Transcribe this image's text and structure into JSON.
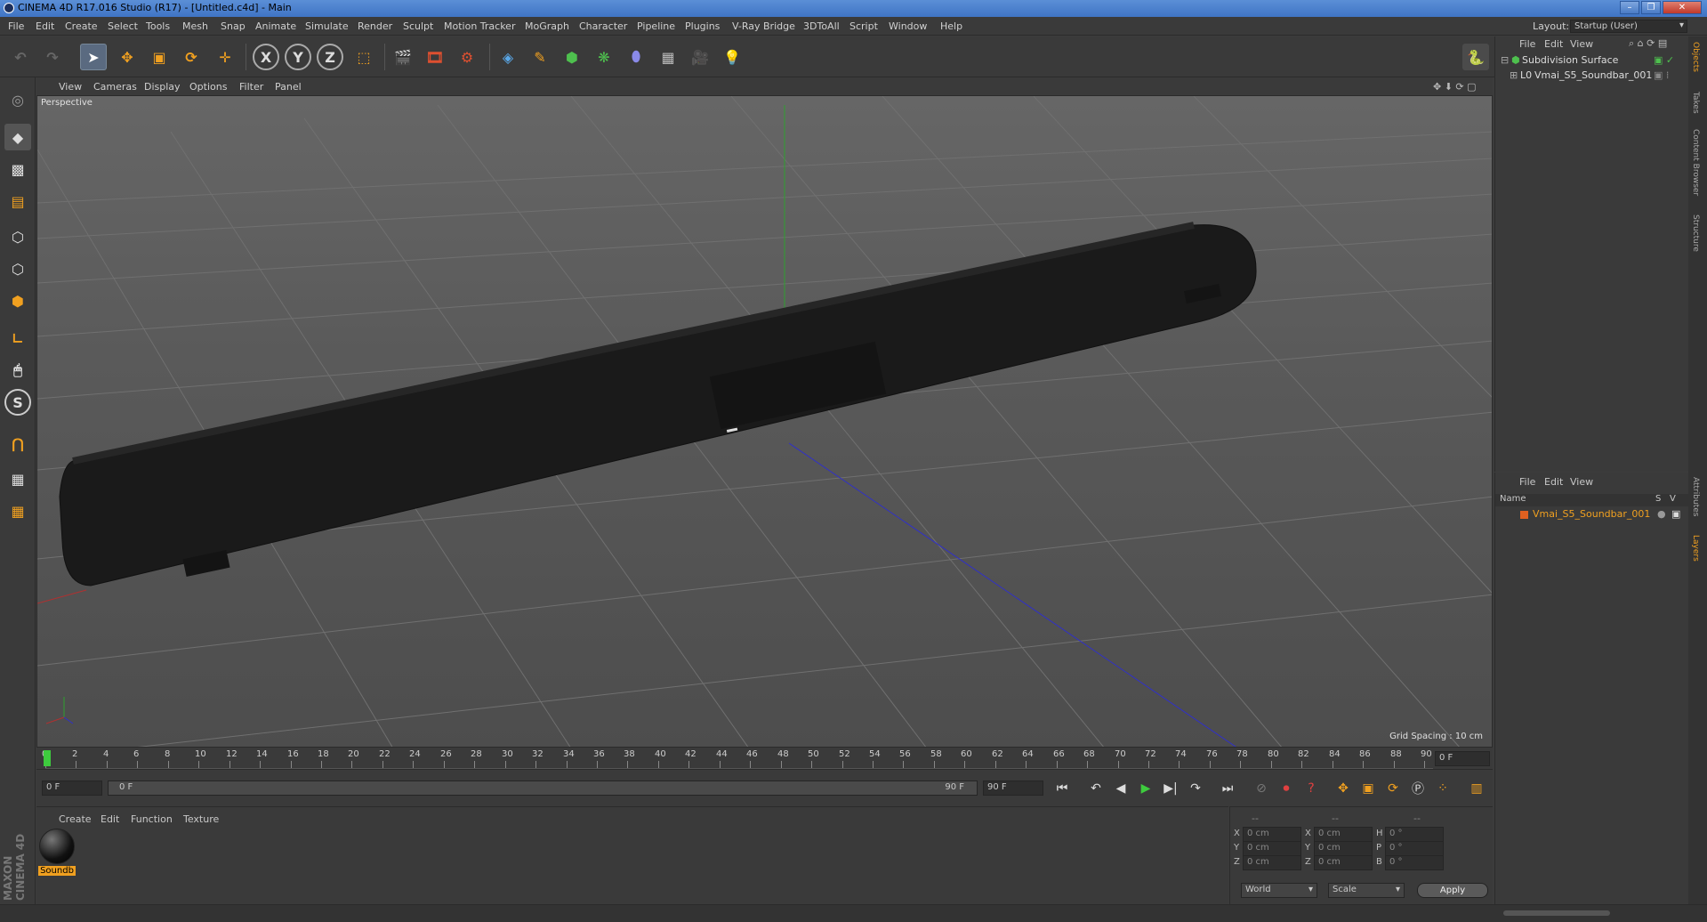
{
  "window": {
    "title": "CINEMA 4D R17.016 Studio (R17) - [Untitled.c4d] - Main"
  },
  "menu": [
    "File",
    "Edit",
    "Create",
    "Select",
    "Tools",
    "Mesh",
    "Snap",
    "Animate",
    "Simulate",
    "Render",
    "Sculpt",
    "Motion Tracker",
    "MoGraph",
    "Character",
    "Pipeline",
    "Plugins",
    "V-Ray Bridge",
    "3DToAll",
    "Script",
    "Window",
    "Help"
  ],
  "layout": {
    "label": "Layout:",
    "value": "Startup (User)"
  },
  "toolbar": {
    "x": "X",
    "y": "Y",
    "z": "Z"
  },
  "viewport": {
    "menu": [
      "View",
      "Cameras",
      "Display",
      "Options",
      "Filter",
      "Panel"
    ],
    "camera_label": "Perspective",
    "grid_spacing": "Grid Spacing : 10 cm"
  },
  "timeline": {
    "ticks": [
      "0",
      "2",
      "4",
      "6",
      "8",
      "10",
      "12",
      "14",
      "16",
      "18",
      "20",
      "22",
      "24",
      "26",
      "28",
      "30",
      "32",
      "34",
      "36",
      "38",
      "40",
      "42",
      "44",
      "46",
      "48",
      "50",
      "52",
      "54",
      "56",
      "58",
      "60",
      "62",
      "64",
      "66",
      "68",
      "70",
      "72",
      "74",
      "76",
      "78",
      "80",
      "82",
      "84",
      "86",
      "88",
      "90"
    ],
    "current_frame": "0 F"
  },
  "transport": {
    "start": "0 F",
    "range_start": "0 F",
    "range_end": "90 F",
    "end": "90 F"
  },
  "materials": {
    "menu": [
      "Create",
      "Edit",
      "Function",
      "Texture"
    ],
    "items": [
      {
        "name": "Soundb"
      }
    ]
  },
  "coords": {
    "headers": [
      "--",
      "--",
      "--"
    ],
    "rows": [
      {
        "a": "X",
        "av": "0 cm",
        "b": "X",
        "bv": "0 cm",
        "c": "H",
        "cv": "0 °"
      },
      {
        "a": "Y",
        "av": "0 cm",
        "b": "Y",
        "bv": "0 cm",
        "c": "P",
        "cv": "0 °"
      },
      {
        "a": "Z",
        "av": "0 cm",
        "b": "Z",
        "bv": "0 cm",
        "c": "B",
        "cv": "0 °"
      }
    ],
    "mode": "World",
    "scale": "Scale",
    "apply": "Apply"
  },
  "objects": {
    "menu": [
      "File",
      "Edit",
      "View"
    ],
    "items": [
      "Subdivision Surface",
      "Vmai_S5_Soundbar_001"
    ]
  },
  "layers": {
    "menu": [
      "File",
      "Edit",
      "View"
    ],
    "columns": [
      "Name",
      "S",
      "V"
    ],
    "items": [
      "Vmai_S5_Soundbar_001"
    ]
  },
  "side_tabs": [
    "Objects",
    "Takes",
    "Content Browser",
    "Structure",
    "Attributes",
    "Layers"
  ],
  "brand": "MAXON CINEMA 4D"
}
